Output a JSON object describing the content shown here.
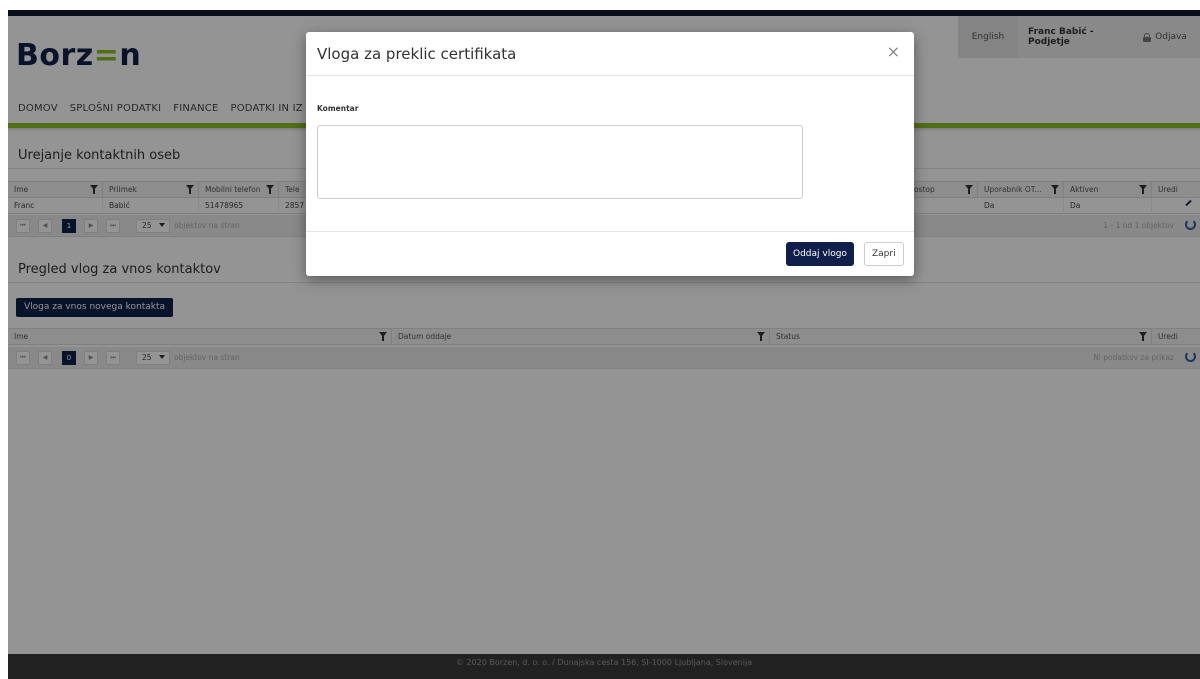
{
  "header": {
    "logo_prefix": "Borz",
    "logo_mid": "=",
    "logo_suffix": "n",
    "language": "English",
    "user": "Franc Babić - Podjetje",
    "logout": "Odjava"
  },
  "nav": [
    "DOMOV",
    "SPLOŠNI PODATKI",
    "FINANCE",
    "PODATKI IN IZ"
  ],
  "contacts": {
    "title": "Urejanje kontaktnih oseb",
    "columns": [
      "Ime",
      "Priimek",
      "Mobilni telefon",
      "Tele",
      "ostop",
      "Uporabnik OT...",
      "Aktiven",
      "Uredi"
    ],
    "rows": [
      {
        "ime": "Franc",
        "priimek": "Babić",
        "mobilni": "51478965",
        "telefon": "2857",
        "uporabnik": "Da",
        "aktiven": "Da"
      }
    ],
    "pager": {
      "page": "1",
      "page_size": "25",
      "per_page_label": "objektov na stran",
      "summary": "1 - 1 od 1 objektov"
    }
  },
  "requests": {
    "title": "Pregled vlog za vnos kontaktov",
    "new_button": "Vloga za vnos novega kontakta",
    "columns": [
      "Ime",
      "Datum oddaje",
      "Status",
      "Uredi"
    ],
    "pager": {
      "page": "0",
      "page_size": "25",
      "per_page_label": "objektov na stran",
      "summary": "Ni podatkov za prikaz"
    }
  },
  "footer": "© 2020 Borzen, d. o. o. / Dunajska cesta 156, SI-1000 Ljubljana, Slovenija",
  "modal": {
    "title": "Vloga za preklic certifikata",
    "close_symbol": "×",
    "comment_label": "Komentar",
    "comment_value": "",
    "submit": "Oddaj vlogo",
    "cancel": "Zapri"
  },
  "icons": {
    "filter": "filter-icon",
    "edit": "edit-icon",
    "refresh": "refresh-icon",
    "lock": "lock-icon",
    "first": "⏮",
    "prev": "◀",
    "next": "▶",
    "last": "⏭"
  },
  "colors": {
    "brand_navy": "#0d1f4a",
    "brand_green": "#8cbf26"
  }
}
